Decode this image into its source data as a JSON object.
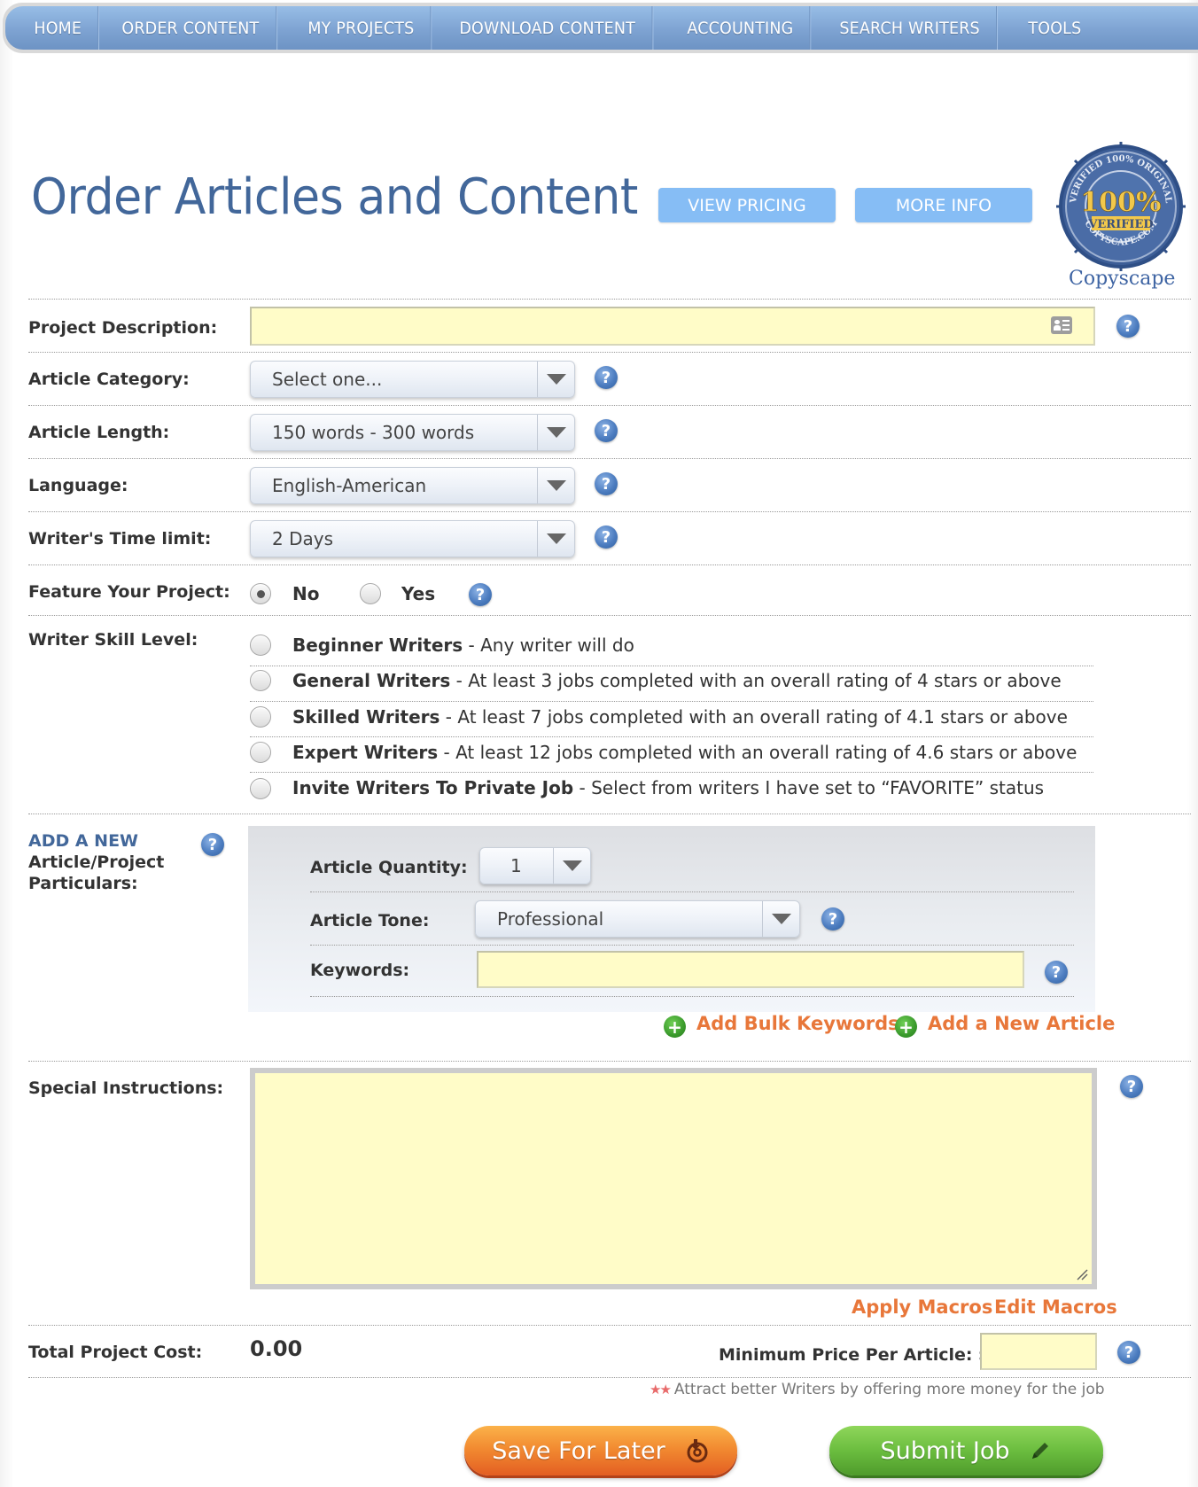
{
  "nav": {
    "items": [
      "HOME",
      "ORDER CONTENT",
      "MY PROJECTS",
      "DOWNLOAD CONTENT",
      "ACCOUNTING",
      "SEARCH WRITERS",
      "TOOLS"
    ]
  },
  "header": {
    "title": "Order Articles and Content",
    "view_pricing": "VIEW PRICING",
    "more_info": "MORE INFO",
    "badge": {
      "ring_top": "VERIFIED 100% ORIGINAL",
      "ring_bottom": "COPYSCAPE.COM",
      "big": "100%",
      "sub": "VERIFIED",
      "label": "Copyscape"
    }
  },
  "form": {
    "project_description": {
      "label": "Project Description:",
      "value": "",
      "icon": "contact-card-icon"
    },
    "article_category": {
      "label": "Article Category:",
      "value": "Select one..."
    },
    "article_length": {
      "label": "Article Length:",
      "value": "150 words - 300 words"
    },
    "language": {
      "label": "Language:",
      "value": "English-American"
    },
    "time_limit": {
      "label": "Writer's Time limit:",
      "value": "2 Days"
    },
    "feature": {
      "label": "Feature Your Project:",
      "options": [
        "No",
        "Yes"
      ],
      "selected": "No"
    },
    "skill": {
      "label": "Writer Skill Level:",
      "options": [
        {
          "name": "Beginner Writers",
          "desc": " - Any writer will do"
        },
        {
          "name": "General Writers",
          "desc": " - At least 3 jobs completed with an overall rating of 4 stars or above"
        },
        {
          "name": "Skilled Writers",
          "desc": " - At least 7 jobs completed with an overall rating of 4.1 stars or above"
        },
        {
          "name": "Expert Writers",
          "desc": " - At least 12 jobs completed with an overall rating of 4.6 stars or above"
        },
        {
          "name": "Invite Writers To Private Job",
          "desc": " - Select from writers I have set to “FAVORITE” status"
        }
      ],
      "selected": null
    },
    "particulars": {
      "heading": "ADD A NEW",
      "label_line1": "Article/Project",
      "label_line2": "Particulars:",
      "quantity": {
        "label": "Article Quantity:",
        "value": "1"
      },
      "tone": {
        "label": "Article Tone:",
        "value": "Professional"
      },
      "keywords": {
        "label": "Keywords:",
        "value": ""
      },
      "add_bulk_keywords": "Add Bulk Keywords",
      "add_new_article": "Add a New Article"
    },
    "special_instructions": {
      "label": "Special Instructions:",
      "value": ""
    },
    "apply_macros": "Apply Macros",
    "edit_macros": "Edit Macros",
    "total_cost": {
      "label": "Total Project Cost:",
      "value": "0.00"
    },
    "min_price": {
      "label": "Minimum Price Per Article: $",
      "value": ""
    },
    "hint": "Attract better Writers by offering more money for the job",
    "hint_stars": "★★"
  },
  "actions": {
    "save": "Save For Later",
    "submit": "Submit Job"
  },
  "colors": {
    "title": "#42679a",
    "link_orange": "#e8773a",
    "field_yellow": "#fffcc8",
    "button_blue": "#86bdf5",
    "save_orange": "#f28b31",
    "submit_green": "#6bbd3f"
  }
}
